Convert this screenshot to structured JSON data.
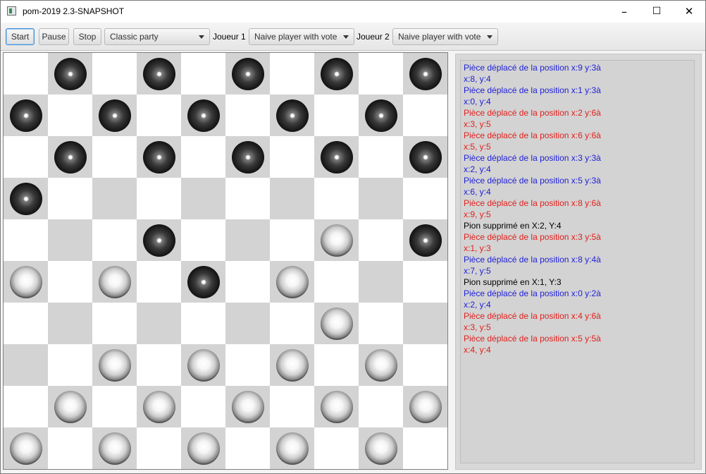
{
  "window": {
    "title": "pom-2019 2.3-SNAPSHOT",
    "minimize_glyph": "–",
    "maximize_glyph": "☐",
    "close_glyph": "✕"
  },
  "toolbar": {
    "start_label": "Start",
    "pause_label": "Pause",
    "stop_label": "Stop",
    "mode_value": "Classic party",
    "player1_label": "Joueur 1",
    "player1_value": "Naive player with vote",
    "player2_label": "Joueur 2",
    "player2_value": "Naive player with vote"
  },
  "board": {
    "size": 10,
    "colors": {
      "light": "#ffffff",
      "dark": "#d3d3d3"
    },
    "pieces": [
      {
        "row": 0,
        "col": 1,
        "color": "black"
      },
      {
        "row": 0,
        "col": 3,
        "color": "black"
      },
      {
        "row": 0,
        "col": 5,
        "color": "black"
      },
      {
        "row": 0,
        "col": 7,
        "color": "black"
      },
      {
        "row": 0,
        "col": 9,
        "color": "black"
      },
      {
        "row": 1,
        "col": 0,
        "color": "black"
      },
      {
        "row": 1,
        "col": 2,
        "color": "black"
      },
      {
        "row": 1,
        "col": 4,
        "color": "black"
      },
      {
        "row": 1,
        "col": 6,
        "color": "black"
      },
      {
        "row": 1,
        "col": 8,
        "color": "black"
      },
      {
        "row": 2,
        "col": 1,
        "color": "black"
      },
      {
        "row": 2,
        "col": 3,
        "color": "black"
      },
      {
        "row": 2,
        "col": 5,
        "color": "black"
      },
      {
        "row": 2,
        "col": 7,
        "color": "black"
      },
      {
        "row": 2,
        "col": 9,
        "color": "black"
      },
      {
        "row": 3,
        "col": 0,
        "color": "black"
      },
      {
        "row": 4,
        "col": 3,
        "color": "black"
      },
      {
        "row": 4,
        "col": 7,
        "color": "white"
      },
      {
        "row": 4,
        "col": 9,
        "color": "black"
      },
      {
        "row": 5,
        "col": 0,
        "color": "white"
      },
      {
        "row": 5,
        "col": 2,
        "color": "white"
      },
      {
        "row": 5,
        "col": 4,
        "color": "black"
      },
      {
        "row": 5,
        "col": 6,
        "color": "white"
      },
      {
        "row": 6,
        "col": 7,
        "color": "white"
      },
      {
        "row": 7,
        "col": 2,
        "color": "white"
      },
      {
        "row": 7,
        "col": 4,
        "color": "white"
      },
      {
        "row": 7,
        "col": 6,
        "color": "white"
      },
      {
        "row": 7,
        "col": 8,
        "color": "white"
      },
      {
        "row": 8,
        "col": 1,
        "color": "white"
      },
      {
        "row": 8,
        "col": 3,
        "color": "white"
      },
      {
        "row": 8,
        "col": 5,
        "color": "white"
      },
      {
        "row": 8,
        "col": 7,
        "color": "white"
      },
      {
        "row": 8,
        "col": 9,
        "color": "white"
      },
      {
        "row": 9,
        "col": 0,
        "color": "white"
      },
      {
        "row": 9,
        "col": 2,
        "color": "white"
      },
      {
        "row": 9,
        "col": 4,
        "color": "white"
      },
      {
        "row": 9,
        "col": 6,
        "color": "white"
      },
      {
        "row": 9,
        "col": 8,
        "color": "white"
      }
    ]
  },
  "log": {
    "colors": {
      "blue": "#1f1fd6",
      "red": "#e0201c",
      "black": "#000000"
    },
    "lines": [
      {
        "text": "Pièce déplacé de la position x:9 y:3à\nx:8, y:4",
        "color": "blue"
      },
      {
        "text": "Pièce déplacé de la position x:1 y:3à\nx:0, y:4",
        "color": "blue"
      },
      {
        "text": "Pièce déplacé de la position x:2 y:6à\nx:3, y:5",
        "color": "red"
      },
      {
        "text": "Pièce déplacé de la position x:6 y:6à\nx:5, y:5",
        "color": "red"
      },
      {
        "text": "Pièce déplacé de la position x:3 y:3à\nx:2, y:4",
        "color": "blue"
      },
      {
        "text": "Pièce déplacé de la position x:5 y:3à\nx:6, y:4",
        "color": "blue"
      },
      {
        "text": "Pièce déplacé de la position x:8 y:6à\nx:9, y:5",
        "color": "red"
      },
      {
        "text": "Pion supprimé en X:2, Y:4",
        "color": "black"
      },
      {
        "text": "Pièce déplacé de la position x:3 y:5à\nx:1, y:3",
        "color": "red"
      },
      {
        "text": "Pièce déplacé de la position x:8 y:4à\nx:7, y:5",
        "color": "blue"
      },
      {
        "text": "Pion supprimé en X:1, Y:3",
        "color": "black"
      },
      {
        "text": "Pièce déplacé de la position x:0 y:2à\nx:2, y:4",
        "color": "blue"
      },
      {
        "text": "Pièce déplacé de la position x:4 y:6à\nx:3, y:5",
        "color": "red"
      },
      {
        "text": "Pièce déplacé de la position x:5 y:5à\nx:4, y:4",
        "color": "red"
      }
    ]
  }
}
